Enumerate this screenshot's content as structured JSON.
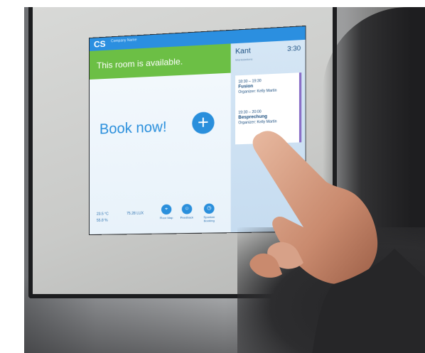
{
  "screen": {
    "logo": "CS",
    "logo_sub": "Company Name",
    "status_text": "This room is available.",
    "book_text": "Book now!",
    "plus_symbol": "+",
    "room_name": "Kant",
    "current_time": "3:30",
    "room_subtitle": "Workstations",
    "events": [
      {
        "time": "18:30 – 19:30",
        "title": "Fusion",
        "subtitle": "Organizer: Kelly Martin"
      },
      {
        "time": "19:30 – 20:00",
        "title": "Besprechung",
        "subtitle": "Organizer: Kelly Martin"
      }
    ],
    "stats": {
      "temperature": "23.5 °C",
      "humidity": "55.8 %",
      "light": "75.28 LUX"
    },
    "buttons": [
      "Floor Map",
      "Feedback",
      "Spontan Booking"
    ],
    "colors": {
      "accent": "#2a8fdc",
      "available": "#6cbf45",
      "agenda_marker": "#8a6fc7"
    }
  }
}
